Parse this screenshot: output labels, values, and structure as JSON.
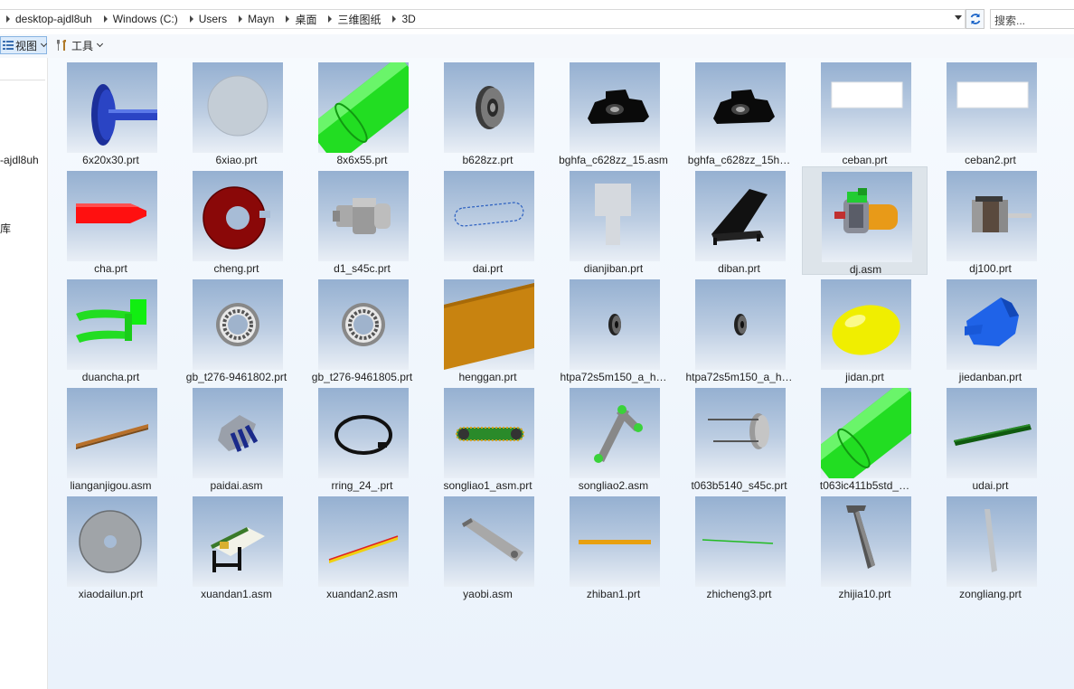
{
  "address": {
    "crumbs": [
      "desktop-ajdl8uh",
      "Windows (C:)",
      "Users",
      "Mayn",
      "桌面",
      "三维图纸",
      "3D"
    ]
  },
  "search": {
    "placeholder": "搜索..."
  },
  "toolbar": {
    "view_label": "视图",
    "tools_label": "工具"
  },
  "nav": {
    "items": [
      "-ajdl8uh",
      "库"
    ]
  },
  "files": [
    {
      "name": "6x20x30.prt",
      "icon": "shaft-part"
    },
    {
      "name": "6xiao.prt",
      "icon": "disc-part"
    },
    {
      "name": "8x6x55.prt",
      "icon": "cylinder-part"
    },
    {
      "name": "b628zz.prt",
      "icon": "bearing-part"
    },
    {
      "name": "bghfa_c628zz_15.asm",
      "icon": "bearing-block-assembly"
    },
    {
      "name": "bghfa_c628zz_15h…",
      "icon": "bearing-block-assembly"
    },
    {
      "name": "ceban.prt",
      "icon": "plate-part"
    },
    {
      "name": "ceban2.prt",
      "icon": "plate-part"
    },
    {
      "name": "cha.prt",
      "icon": "fork-part"
    },
    {
      "name": "cheng.prt",
      "icon": "ring-part"
    },
    {
      "name": "d1_s45c.prt",
      "icon": "nut-part"
    },
    {
      "name": "dai.prt",
      "icon": "belt-part"
    },
    {
      "name": "dianjiban.prt",
      "icon": "bracket-part"
    },
    {
      "name": "diban.prt",
      "icon": "base-part"
    },
    {
      "name": "dj.asm",
      "icon": "motor-assembly",
      "selected": true
    },
    {
      "name": "dj100.prt",
      "icon": "stepper-motor-part"
    },
    {
      "name": "duancha.prt",
      "icon": "hook-part"
    },
    {
      "name": "gb_t276-9461802.prt",
      "icon": "ball-bearing-part"
    },
    {
      "name": "gb_t276-9461805.prt",
      "icon": "ball-bearing-part"
    },
    {
      "name": "henggan.prt",
      "icon": "beam-part"
    },
    {
      "name": "htpa72s5m150_a_h…",
      "icon": "pulley-part"
    },
    {
      "name": "htpa72s5m150_a_h…",
      "icon": "pulley-part"
    },
    {
      "name": "jidan.prt",
      "icon": "egg-part"
    },
    {
      "name": "jiedanban.prt",
      "icon": "tray-part"
    },
    {
      "name": "lianganjigou.asm",
      "icon": "linkage-assembly"
    },
    {
      "name": "paidai.asm",
      "icon": "belt-assembly"
    },
    {
      "name": "rring_24_.prt",
      "icon": "retaining-ring-part"
    },
    {
      "name": "songliao1_asm.prt",
      "icon": "conveyor-part"
    },
    {
      "name": "songliao2.asm",
      "icon": "conveyor-assembly"
    },
    {
      "name": "t063b5140_s45c.prt",
      "icon": "pin-part"
    },
    {
      "name": "t063ic411b5std_…",
      "icon": "cylinder-part"
    },
    {
      "name": "udai.prt",
      "icon": "channel-part"
    },
    {
      "name": "xiaodailun.prt",
      "icon": "wheel-part"
    },
    {
      "name": "xuandan1.asm",
      "icon": "machine-assembly"
    },
    {
      "name": "xuandan2.asm",
      "icon": "roller-assembly"
    },
    {
      "name": "yaobi.asm",
      "icon": "arm-assembly"
    },
    {
      "name": "zhiban1.prt",
      "icon": "bar-part"
    },
    {
      "name": "zhicheng3.prt",
      "icon": "rod-part"
    },
    {
      "name": "zhijia10.prt",
      "icon": "t-bracket-part"
    },
    {
      "name": "zongliang.prt",
      "icon": "beam-part"
    }
  ]
}
